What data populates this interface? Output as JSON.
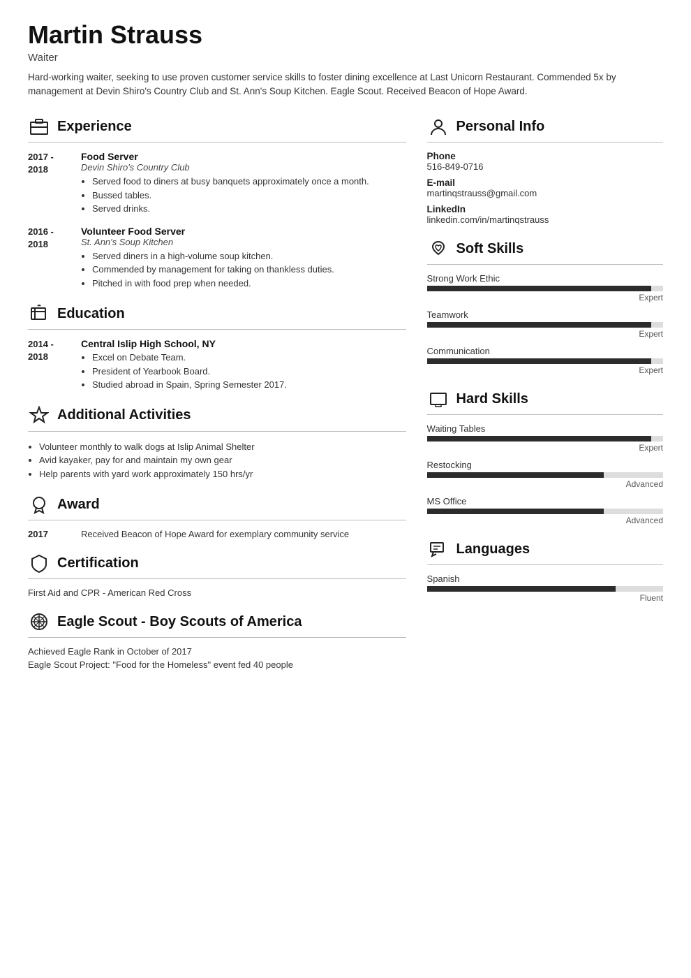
{
  "header": {
    "name": "Martin Strauss",
    "title": "Waiter",
    "summary": "Hard-working waiter, seeking to use proven customer service skills to foster dining excellence at Last Unicorn Restaurant. Commended 5x by management at Devin Shiro's Country Club and St. Ann's Soup Kitchen. Eagle Scout. Received Beacon of Hope Award."
  },
  "left": {
    "experience_section": "Experience",
    "experience_items": [
      {
        "date": "2017 -\n2018",
        "title": "Food Server",
        "company": "Devin Shiro's Country Club",
        "bullets": [
          "Served food to diners at busy banquets approximately once a month.",
          "Bussed tables.",
          "Served drinks."
        ]
      },
      {
        "date": "2016 -\n2018",
        "title": "Volunteer Food Server",
        "company": "St. Ann's Soup Kitchen",
        "bullets": [
          "Served diners in a high-volume soup kitchen.",
          "Commended by management for taking on thankless duties.",
          "Pitched in with food prep when needed."
        ]
      }
    ],
    "education_section": "Education",
    "education_items": [
      {
        "date": "2014 -\n2018",
        "title": "Central Islip High School, NY",
        "bullets": [
          "Excel on Debate Team.",
          "President of Yearbook Board.",
          "Studied abroad in Spain, Spring Semester 2017."
        ]
      }
    ],
    "activities_section": "Additional Activities",
    "activities_bullets": [
      "Volunteer monthly to walk dogs at Islip Animal Shelter",
      "Avid kayaker, pay for and maintain my own gear",
      "Help parents with yard work approximately 150 hrs/yr"
    ],
    "award_section": "Award",
    "award_items": [
      {
        "year": "2017",
        "text": "Received Beacon of Hope Award for exemplary community service"
      }
    ],
    "certification_section": "Certification",
    "certification_items": [
      "First Aid and CPR - American Red Cross"
    ],
    "eagle_section": "Eagle Scout - Boy Scouts of America",
    "eagle_items": [
      "Achieved Eagle Rank in October of 2017",
      "Eagle Scout Project: \"Food for the Homeless\" event fed 40 people"
    ]
  },
  "right": {
    "personal_section": "Personal Info",
    "phone_label": "Phone",
    "phone_value": "516-849-0716",
    "email_label": "E-mail",
    "email_value": "martinqstrauss@gmail.com",
    "linkedin_label": "LinkedIn",
    "linkedin_value": "linkedin.com/in/martinqstrauss",
    "soft_skills_section": "Soft Skills",
    "soft_skills": [
      {
        "name": "Strong Work Ethic",
        "level": "Expert",
        "pct": 95
      },
      {
        "name": "Teamwork",
        "level": "Expert",
        "pct": 95
      },
      {
        "name": "Communication",
        "level": "Expert",
        "pct": 95
      }
    ],
    "hard_skills_section": "Hard Skills",
    "hard_skills": [
      {
        "name": "Waiting Tables",
        "level": "Expert",
        "pct": 95
      },
      {
        "name": "Restocking",
        "level": "Advanced",
        "pct": 75
      },
      {
        "name": "MS Office",
        "level": "Advanced",
        "pct": 75
      }
    ],
    "languages_section": "Languages",
    "languages": [
      {
        "name": "Spanish",
        "level": "Fluent",
        "pct": 80
      }
    ]
  }
}
